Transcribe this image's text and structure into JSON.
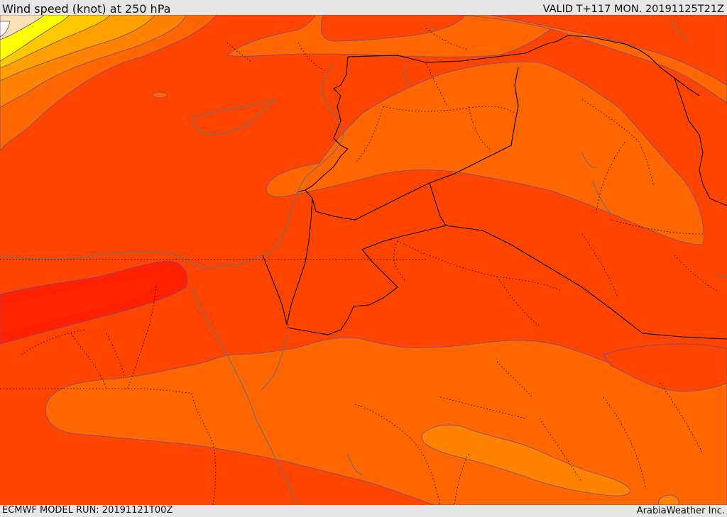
{
  "header": {
    "title": "Wind speed (knot) at 250 hPa",
    "valid": "VALID T+117 MON. 20191125T21Z"
  },
  "footer": {
    "model_run": "ECMWF MODEL RUN: 20191121T00Z",
    "credit": "ArabiaWeather Inc."
  },
  "colors": {
    "white_band": "#fffbf0",
    "cream_band": "#fde0b4",
    "yellow_band": "#ffff00",
    "gold_band": "#ffc800",
    "amber_band": "#ff9f00",
    "light_orange_band": "#ff8200",
    "orange_band": "#ff6600",
    "dark_orange_band": "#ff4400",
    "red_band": "#ff2000",
    "contour": "#6a4f9a",
    "border": "#000000",
    "coast": "#707070"
  }
}
